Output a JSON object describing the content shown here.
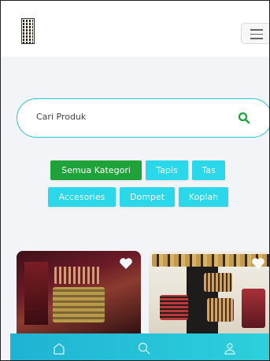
{
  "header": {
    "logo_icon": "woven-tapis-logo-icon",
    "menu_icon": "hamburger-menu-icon"
  },
  "search": {
    "placeholder": "Cari Produk",
    "icon": "search-icon",
    "accent_color": "#27c6da"
  },
  "categories": [
    {
      "label": "Semua Kategori",
      "active": true
    },
    {
      "label": "Tapis",
      "active": false
    },
    {
      "label": "Tas",
      "active": false
    },
    {
      "label": "Accesories",
      "active": false
    },
    {
      "label": "Dompet",
      "active": false
    },
    {
      "label": "Koplah",
      "active": false
    }
  ],
  "colors": {
    "active_chip": "#1fa23a",
    "chip": "#2ad8ea",
    "navbar": "#1fb3d3"
  },
  "products": [
    {
      "image": "tapis-bag-stack-photo",
      "favorite_icon": "heart-icon"
    },
    {
      "image": "woven-bags-display-photo",
      "favorite_icon": "heart-icon"
    }
  ],
  "bottom_nav": [
    {
      "icon": "home-icon"
    },
    {
      "icon": "search-icon"
    },
    {
      "icon": "user-icon"
    }
  ]
}
